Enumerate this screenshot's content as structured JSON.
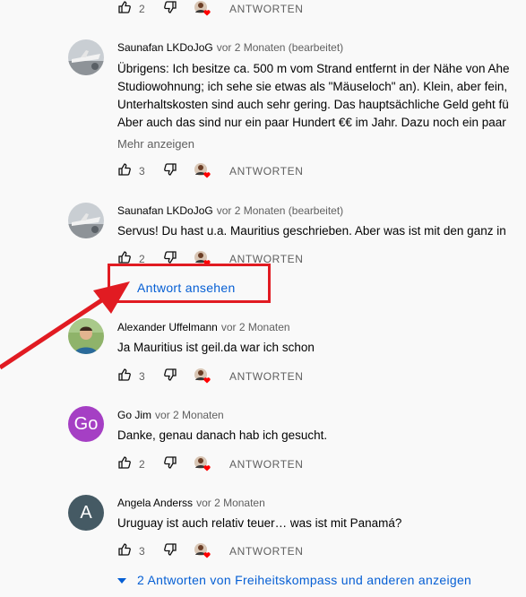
{
  "icons": [
    "thumbs-up-icon",
    "thumbs-down-icon",
    "creator-heart-icon",
    "caret-down-icon"
  ],
  "colors": {
    "link": "#065fd4",
    "annotation": "#e11b22",
    "heart": "#ff0000"
  },
  "reply_label": "ANTWORTEN",
  "top_row": {
    "likes": "2"
  },
  "comments": [
    {
      "author": "Saunafan LKDoJoG",
      "meta": "vor 2 Monaten (bearbeitet)",
      "lines": [
        "Übrigens: Ich besitze ca. 500 m vom Strand entfernt in der Nähe von Ahe",
        "Studiowohnung; ich sehe sie etwas als \"Mäuseloch\" an). Klein, aber fein,",
        "Unterhaltskosten sind auch sehr gering. Das hauptsächliche Geld geht fü",
        "Aber auch das sind nur ein paar Hundert €€ im Jahr. Dazu noch ein paar"
      ],
      "more": "Mehr anzeigen",
      "likes": "3"
    },
    {
      "author": "Saunafan LKDoJoG",
      "meta": "vor 2 Monaten (bearbeitet)",
      "lines": [
        "Servus! Du hast u.a. Mauritius geschrieben. Aber was ist mit den ganz in"
      ],
      "likes": "2",
      "view_replies": "Antwort ansehen"
    },
    {
      "author": "Alexander Uffelmann",
      "meta": "vor 2 Monaten",
      "lines": [
        "Ja Mauritius ist geil.da war ich schon"
      ],
      "likes": "3"
    },
    {
      "author": "Go Jim",
      "meta": "vor 2 Monaten",
      "avatar_letters": "Go",
      "lines": [
        "Danke, genau danach hab ich gesucht."
      ],
      "likes": "2"
    },
    {
      "author": "Angela Anderss",
      "meta": "vor 2 Monaten",
      "avatar_letters": "A",
      "lines": [
        "Uruguay ist auch relativ teuer… was ist mit Panamá?"
      ],
      "likes": "3",
      "view_replies": "2 Antworten von Freiheitskompass und anderen anzeigen"
    }
  ]
}
